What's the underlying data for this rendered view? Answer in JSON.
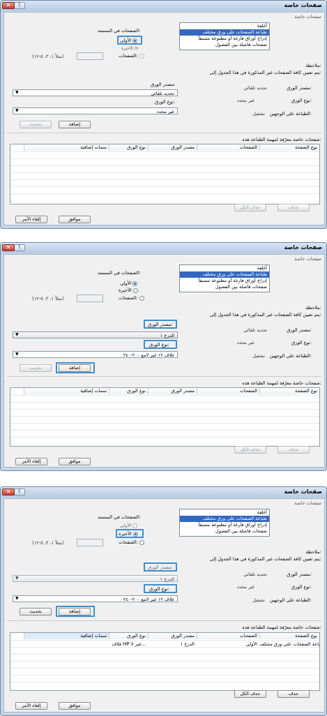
{
  "dialog": {
    "title": "صفحات خاصة",
    "help_label": "؟",
    "close_label": "✕",
    "section_title": "صفحات خاصة",
    "pages_in_doc_label": "الصفحات في المستند:",
    "radio_first": "الأولى",
    "radio_last": "الأخيرة",
    "radio_pages": "الصفحات:",
    "pages_hint": "(مثلاً ١، ٣، ٥-١٢)",
    "list_items": [
      "أغلفة",
      "طباعة الصفحات على ورق مختلف",
      "إدراج أوراق فارغة أو مطبوعة مسبقاً",
      "صفحات فاصلة بين الفصول"
    ],
    "note_label": "ملاحظة:",
    "note_text": "يتم تعيين كافة الصفحات غير المذكورة في هذا الجدول إلى:",
    "paper_source_label": "مصدر الورق:",
    "paper_source_value": "تحديد تلقائي",
    "paper_type_label": "نوع الورق:",
    "paper_type_value": "غير محدد",
    "duplex_label": "الطباعة على الوجهين:",
    "duplex_value": "تشغيل",
    "source_combo_label": "مصدر الورق:",
    "type_combo_label": "نوع الورق:",
    "add_button": "إضافة",
    "update_button": "تحديث",
    "table_caption": "صفحات خاصة معرّفة لمهمة الطباعة هذه:",
    "columns": [
      "نوع الصفحة",
      "الصفحات",
      "مصدر الورق",
      "نوع الورق",
      "سمات إضافية"
    ],
    "delete_button": "حذف",
    "delete_all_button": "حذف الكل",
    "ok_button": "موافق",
    "cancel_button": "إلغاء الأمر"
  },
  "panels": [
    {
      "selected_radio": "first",
      "last_sub": "٧/ الأخيرة",
      "source_combo": "تحديد تلقائي",
      "type_combo": "غير محدد",
      "rows": []
    },
    {
      "selected_radio": "first",
      "last_sub": "",
      "source_combo": "الدرج ١",
      "type_combo": "غلاف ١٢ غير لامع ٢٠٠-٢٤٠",
      "rows": []
    },
    {
      "selected_radio": "last",
      "last_sub": "",
      "source_combo": "الدرج ١",
      "type_combo": "غلاف ١٢ غير لامع ٢٠٠-٢٤٠",
      "rows": [
        {
          "type": "طباعة الصفحات على ورق مختلف",
          "pages": "الأولى",
          "source": "الدرج ١",
          "paper": "غلاف HP غير لا...",
          "extra": ""
        }
      ]
    }
  ]
}
